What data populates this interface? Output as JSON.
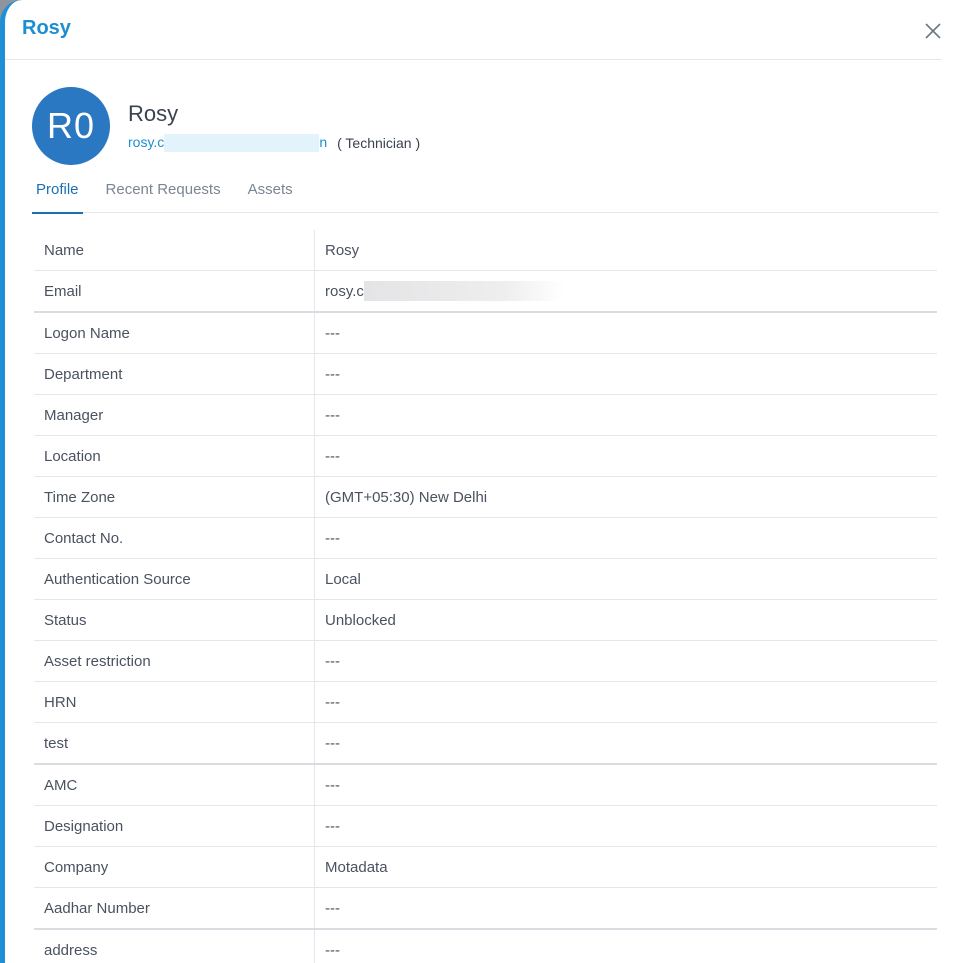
{
  "header": {
    "title": "Rosy",
    "close_icon": "close-icon"
  },
  "profile": {
    "avatar_initials": "R0",
    "name": "Rosy",
    "email_visible_prefix": "rosy.c",
    "email_visible_suffix": "n",
    "role": "( Technician )"
  },
  "tabs": [
    {
      "label": "Profile",
      "active": true
    },
    {
      "label": "Recent Requests",
      "active": false
    },
    {
      "label": "Assets",
      "active": false
    }
  ],
  "fields": [
    {
      "label": "Name",
      "value": "Rosy"
    },
    {
      "label": "Email",
      "value": "rosy.c"
    },
    {
      "label": "Logon Name",
      "value": "---"
    },
    {
      "label": "Department",
      "value": "---"
    },
    {
      "label": "Manager",
      "value": "---"
    },
    {
      "label": "Location",
      "value": "---"
    },
    {
      "label": "Time Zone",
      "value": "(GMT+05:30) New Delhi"
    },
    {
      "label": "Contact No.",
      "value": "---"
    },
    {
      "label": "Authentication Source",
      "value": "Local"
    },
    {
      "label": "Status",
      "value": "Unblocked"
    },
    {
      "label": "Asset restriction",
      "value": "---"
    },
    {
      "label": "HRN",
      "value": "---"
    },
    {
      "label": "test",
      "value": "---"
    },
    {
      "label": "AMC",
      "value": "---"
    },
    {
      "label": "Designation",
      "value": "---"
    },
    {
      "label": "Company",
      "value": "Motadata"
    },
    {
      "label": "Aadhar Number",
      "value": "---"
    },
    {
      "label": "address",
      "value": "---"
    }
  ],
  "colors": {
    "accent": "#1b8fd0",
    "avatar_bg": "#2b78c2",
    "active_tab": "#1b6fb5"
  }
}
